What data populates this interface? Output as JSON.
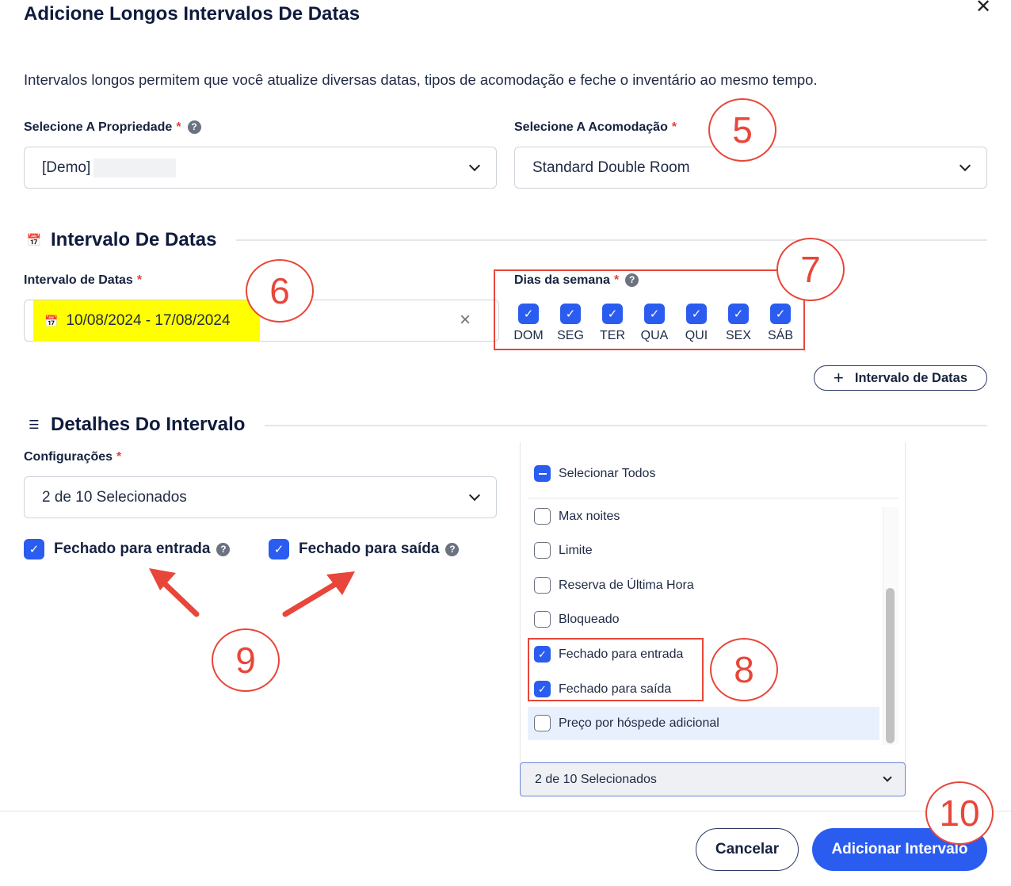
{
  "dialog": {
    "title": "Adicione Longos Intervalos De Datas",
    "description": "Intervalos longos permitem que você atualize diversas datas, tipos de acomodação e feche o inventário ao mesmo tempo.",
    "close_icon": "close-icon"
  },
  "property": {
    "label": "Selecione A Propriedade",
    "required": "*",
    "value": "[Demo]"
  },
  "accommodation": {
    "label": "Selecione A Acomodação",
    "required": "*",
    "value": "Standard Double Room"
  },
  "date_section": {
    "title": "Intervalo De Datas",
    "date_label": "Intervalo de Datas",
    "required": "*",
    "date_value": "10/08/2024 - 17/08/2024",
    "weekdays_label": "Dias da semana",
    "weekdays": [
      "DOM",
      "SEG",
      "TER",
      "QUA",
      "QUI",
      "SEX",
      "SÁB"
    ],
    "add_range_button": "Intervalo de Datas"
  },
  "details_section": {
    "title": "Detalhes Do Intervalo",
    "config_label": "Configurações",
    "required": "*",
    "config_value": "2 de 10 Selecionados",
    "closed_arrival": "Fechado para entrada",
    "closed_departure": "Fechado para saída"
  },
  "dropdown": {
    "select_all": "Selecionar Todos",
    "options": [
      {
        "label": "Max noites",
        "checked": false
      },
      {
        "label": "Limite",
        "checked": false
      },
      {
        "label": "Reserva de Última Hora",
        "checked": false
      },
      {
        "label": "Bloqueado",
        "checked": false
      },
      {
        "label": "Fechado para entrada",
        "checked": true
      },
      {
        "label": "Fechado para saída",
        "checked": true
      },
      {
        "label": "Preço por hóspede adicional",
        "checked": false
      }
    ],
    "summary": "2 de 10 Selecionados"
  },
  "annotations": {
    "n5": "5",
    "n6": "6",
    "n7": "7",
    "n8": "8",
    "n9": "9",
    "n10": "10"
  },
  "footer": {
    "cancel": "Cancelar",
    "submit": "Adicionar Intervalo"
  },
  "colors": {
    "primary": "#2b5cf0",
    "annotation": "#e8463a",
    "highlight": "#ffff00",
    "required": "#e0433a"
  }
}
